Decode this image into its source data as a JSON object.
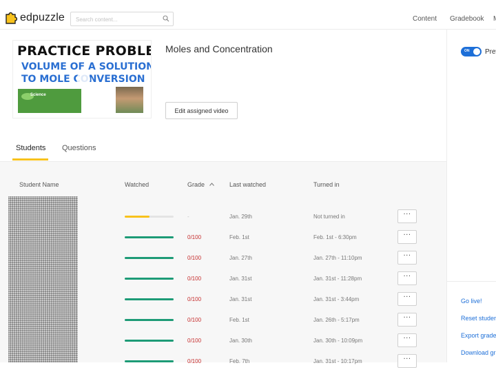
{
  "app": {
    "logo_text": "edpuzzle",
    "search_placeholder": "Search content...",
    "nav": [
      "Content",
      "Gradebook",
      "M"
    ]
  },
  "video": {
    "title": "Moles and Concentration",
    "thumbnail_lines": [
      "PRACTICE PROBLEM",
      "VOLUME OF A SOLUTION",
      "TO MOLE CONVERSION"
    ],
    "thumbnail_badge": "Science",
    "edit_button": "Edit assigned video"
  },
  "tabs": [
    "Students",
    "Questions"
  ],
  "table": {
    "headers": {
      "name": "Student Name",
      "watched": "Watched",
      "grade": "Grade",
      "last_watched": "Last watched",
      "turned_in": "Turned in"
    },
    "rows": [
      {
        "watched": 0.5,
        "watched_color": "#f8c21c",
        "grade": "-",
        "last": "Jan. 29th",
        "turned": "Not turned in"
      },
      {
        "watched": 1.0,
        "watched_color": "#1d9b76",
        "grade": "0/100",
        "last": "Feb. 1st",
        "turned": "Feb. 1st - 6:30pm"
      },
      {
        "watched": 1.0,
        "watched_color": "#1d9b76",
        "grade": "0/100",
        "last": "Jan. 27th",
        "turned": "Jan. 27th - 11:10pm"
      },
      {
        "watched": 1.0,
        "watched_color": "#1d9b76",
        "grade": "0/100",
        "last": "Jan. 31st",
        "turned": "Jan. 31st - 11:28pm"
      },
      {
        "watched": 1.0,
        "watched_color": "#1d9b76",
        "grade": "0/100",
        "last": "Jan. 31st",
        "turned": "Jan. 31st - 3:44pm"
      },
      {
        "watched": 1.0,
        "watched_color": "#1d9b76",
        "grade": "0/100",
        "last": "Feb. 1st",
        "turned": "Jan. 26th - 5:17pm"
      },
      {
        "watched": 1.0,
        "watched_color": "#1d9b76",
        "grade": "0/100",
        "last": "Jan. 30th",
        "turned": "Jan. 30th - 10:09pm"
      },
      {
        "watched": 1.0,
        "watched_color": "#1d9b76",
        "grade": "0/100",
        "last": "Feb. 7th",
        "turned": "Jan. 31st - 10:17pm"
      }
    ],
    "more_label": "···"
  },
  "side": {
    "toggle_label": "ON",
    "preview_label": "Prev",
    "links": [
      "Go live!",
      "Reset studer",
      "Export grade",
      "Download gr"
    ]
  },
  "colors": {
    "accent_yellow": "#f8c21c",
    "watched_green": "#1d9b76",
    "grade_red": "#c62d2d",
    "link_blue": "#1d6fd8"
  }
}
